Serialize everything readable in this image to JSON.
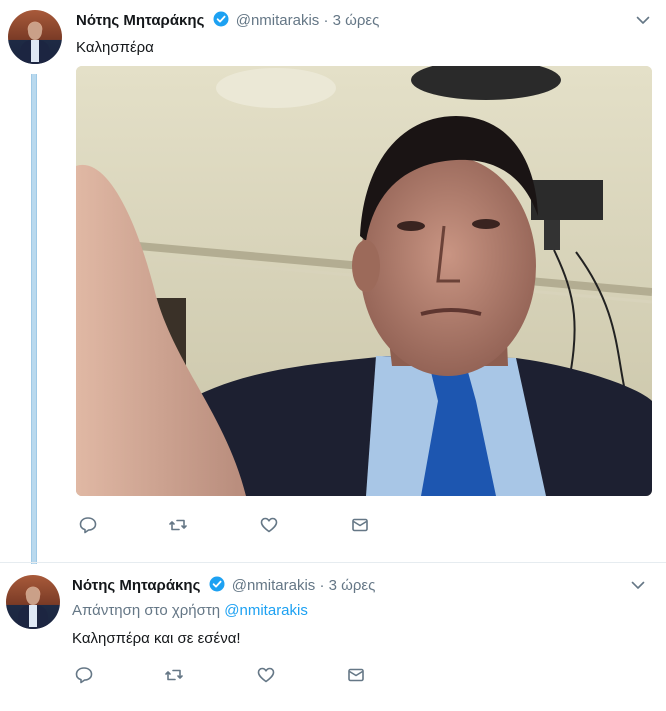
{
  "tweet1": {
    "name": "Νότης Μηταράκης",
    "handle": "@nmitarakis",
    "sep": "·",
    "time": "3 ώρες",
    "text": "Καλησπέρα"
  },
  "tweet2": {
    "name": "Νότης Μηταράκης",
    "handle": "@nmitarakis",
    "sep": "·",
    "time": "3 ώρες",
    "reply_prefix": "Απάντηση στο χρήστη",
    "reply_handle": "@nmitarakis",
    "text": "Καλησπέρα και σε εσένα!"
  },
  "icons": {
    "reply": "reply-icon",
    "retweet": "retweet-icon",
    "like": "heart-icon",
    "dm": "envelope-icon",
    "menu": "chevron-down-icon",
    "verified": "verified-badge-icon"
  },
  "colors": {
    "accent": "#1da1f2",
    "muted": "#657786",
    "thread": "#b9d9ee"
  }
}
